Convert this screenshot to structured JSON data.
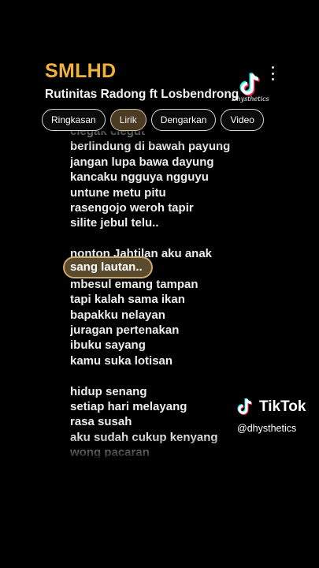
{
  "card": {
    "title": "SMLHD",
    "subtitle": "Rutinitas Radong ft Losbendrong",
    "more_icon": "more-vertical-icon"
  },
  "tabs": [
    {
      "label": "Ringkasan",
      "active": false
    },
    {
      "label": "Lirik",
      "active": true
    },
    {
      "label": "Dengarkan",
      "active": false
    },
    {
      "label": "Video",
      "active": false
    }
  ],
  "lyrics": {
    "lines_before": [
      "clegak clegut",
      "berlindung di bawah payung",
      "jangan lupa bawa dayung",
      "kancaku ngguya ngguyu",
      "untune metu pitu",
      "rasengojo weroh tapir",
      "silite jebul telu..",
      "",
      "nonton Jahtilan aku anak"
    ],
    "current_line": "sang lautan..",
    "lines_after": [
      "mbesul emang tampan",
      "tapi kalah sama ikan",
      "bapakku nelayan",
      "juragan pertenakan",
      "ibuku sayang",
      "kamu suka lotisan",
      "",
      "hidup senang",
      "setiap hari melayang",
      "rasa susah",
      "aku sudah cukup kenyang",
      "wong pacaran"
    ]
  },
  "watermark": {
    "brand_script": "Dhysthetics",
    "tiktok_word": "TikTok",
    "handle": "@dhysthetics",
    "logo_icon": "tiktok-logo-icon"
  },
  "colors": {
    "title": "#f0b23e",
    "highlight_fill": "#5a4a2e",
    "highlight_border": "#c9a66b",
    "background": "#000000"
  }
}
